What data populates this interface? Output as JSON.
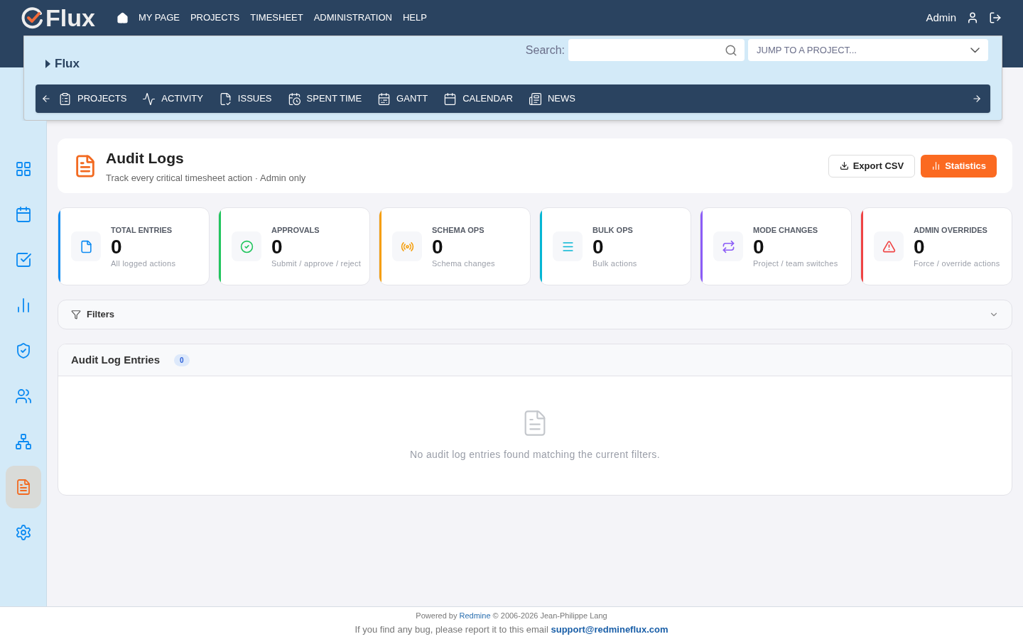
{
  "top_nav": {
    "logo": "Flux",
    "items": [
      "MY PAGE",
      "PROJECTS",
      "TIMESHEET",
      "ADMINISTRATION",
      "HELP"
    ],
    "user": "Admin"
  },
  "project_header": {
    "title": "Flux",
    "search_label": "Search:",
    "jump": {
      "placeholder": "JUMP TO A PROJECT..."
    }
  },
  "project_menu": [
    "PROJECTS",
    "ACTIVITY",
    "ISSUES",
    "SPENT TIME",
    "GANTT",
    "CALENDAR",
    "NEWS"
  ],
  "sidebar": {
    "items": [
      {
        "selected": false
      },
      {
        "selected": false
      },
      {
        "selected": false
      },
      {
        "selected": false
      },
      {
        "selected": false
      },
      {
        "selected": false
      },
      {
        "selected": false
      },
      {
        "selected": true
      },
      {
        "selected": false
      }
    ]
  },
  "page_header": {
    "title": "Audit Logs",
    "subtitle": "Track every critical timesheet action · Admin only",
    "buttons": [
      {
        "label": "Export CSV",
        "kind": "secondary"
      },
      {
        "label": "Statistics",
        "kind": "primary"
      }
    ]
  },
  "stats": [
    {
      "label": "TOTAL ENTRIES",
      "value": "0",
      "note": "All logged actions",
      "color": "#0d8bf2"
    },
    {
      "label": "APPROVALS",
      "value": "0",
      "note": "Submit / approve / reject",
      "color": "#22c55e"
    },
    {
      "label": "SCHEMA OPS",
      "value": "0",
      "note": "Schema changes",
      "color": "#f59e0b"
    },
    {
      "label": "BULK OPS",
      "value": "0",
      "note": "Bulk actions",
      "color": "#06b6d4"
    },
    {
      "label": "MODE CHANGES",
      "value": "0",
      "note": "Project / team switches",
      "color": "#8b5cf6"
    },
    {
      "label": "ADMIN OVERRIDES",
      "value": "0",
      "note": "Force / override actions",
      "color": "#ef4444"
    }
  ],
  "filters": {
    "label": "Filters",
    "expanded": false
  },
  "entries": {
    "title": "Audit Log Entries",
    "count": "0",
    "empty_message": "No audit log entries found matching the current filters."
  },
  "footer": {
    "powered_prefix": "Powered by",
    "powered_link": "Redmine",
    "powered_suffix": "© 2006-2026 Jean-Philippe Lang",
    "bug_text": "If you find any bug, please report it to this email",
    "bug_email": "support@redmineflux.com"
  }
}
